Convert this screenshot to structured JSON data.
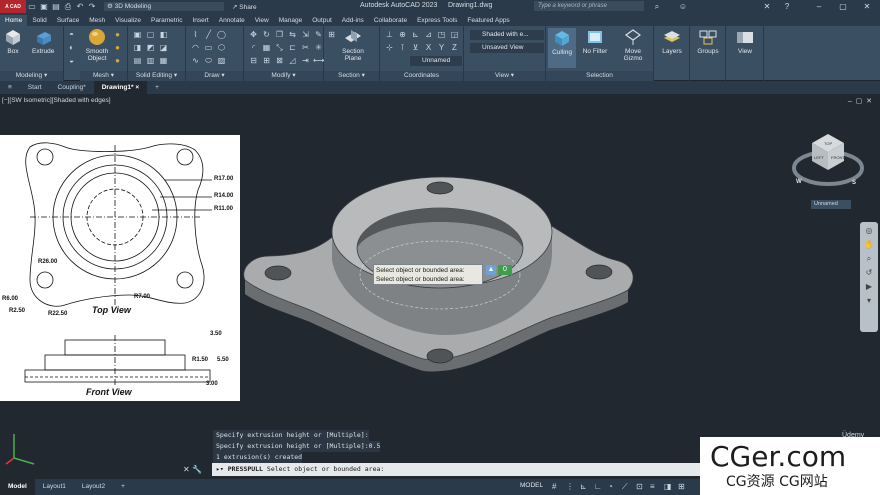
{
  "titlebar": {
    "logo": "A CAD",
    "workspace": "3D Modeling",
    "share": "Share",
    "app_title": "Autodesk AutoCAD 2023",
    "doc_title": "Drawing1.dwg",
    "search_placeholder": "Type a keyword or phrase"
  },
  "ribbon_tabs": [
    "Home",
    "Solid",
    "Surface",
    "Mesh",
    "Visualize",
    "Parametric",
    "Insert",
    "Annotate",
    "View",
    "Manage",
    "Output",
    "Add-ins",
    "Collaborate",
    "Express Tools",
    "Featured Apps"
  ],
  "ribbon": {
    "box": "Box",
    "extrude": "Extrude",
    "smooth_object": "Smooth Object",
    "section_plane": "Section Plane",
    "visual_style": "Shaded with e...",
    "view_select": "Unsaved View",
    "coord_name": "Unnamed",
    "culling": "Culling",
    "no_filter": "No Filter",
    "move_gizmo": "Move Gizmo",
    "layers": "Layers",
    "groups": "Groups",
    "view": "View",
    "panels": {
      "modeling": "Modeling",
      "mesh": "Mesh",
      "solid_editing": "Solid Editing",
      "draw": "Draw",
      "modify": "Modify",
      "section": "Section",
      "coordinates": "Coordinates",
      "view": "View",
      "selection": "Selection"
    }
  },
  "file_tabs": [
    "Start",
    "Coupling*",
    "Drawing1*"
  ],
  "viewport": {
    "controls": "[−][SW Isometric][Shaded with edges]",
    "ucs_name": "Unnamed",
    "tooltip_line1": "Select object or bounded area:",
    "tooltip_line2": "Select object or bounded area:",
    "dynamic_value": "0"
  },
  "reference": {
    "top_view_label": "Top View",
    "front_view_label": "Front View",
    "dims": {
      "r17": "R17.00",
      "r14": "R14.00",
      "r11": "R11.00",
      "r26": "R26.00",
      "r6": "R6.00",
      "r25": "R2.50",
      "r225": "R22.50",
      "r7": "R7.00",
      "d35": "3.50",
      "r15": "R1.50",
      "d55": "5.50",
      "d3": "3.00"
    }
  },
  "viewcube": {
    "top": "TOP",
    "left": "LEFT",
    "front": "FRONT",
    "w": "W",
    "s": "S"
  },
  "command": {
    "history": [
      "Specify extrusion height or [Multiple]:",
      "Specify extrusion height or [Multiple]:0.5",
      "1 extrusion(s) created"
    ],
    "prompt_cmd": "PRESSPULL",
    "prompt_text": "Select object or bounded area:"
  },
  "status": {
    "tabs": [
      "Model",
      "Layout1",
      "Layout2"
    ],
    "model_btn": "MODEL"
  },
  "watermark": {
    "line1": "CGer.com",
    "line2": "CG资源  CG网站"
  },
  "udemy": "Üdemy"
}
